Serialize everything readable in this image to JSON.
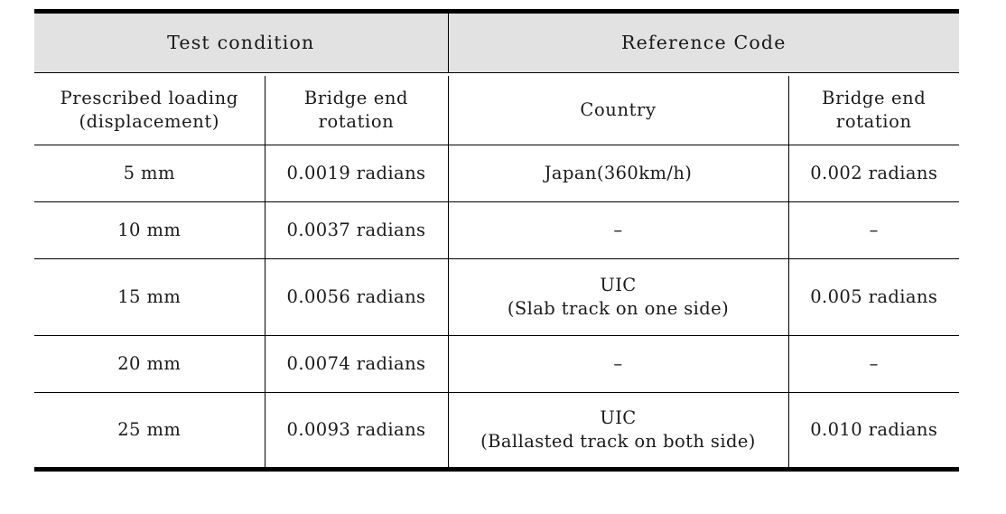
{
  "table": {
    "group_headers": [
      {
        "label": "Test condition",
        "colspan": 2
      },
      {
        "label": "Reference Code",
        "colspan": 2
      }
    ],
    "sub_headers": [
      {
        "line1": "Prescribed loading",
        "line2": "(displacement)"
      },
      {
        "line1": "Bridge end",
        "line2": "rotation"
      },
      {
        "line1": "Country",
        "line2": ""
      },
      {
        "line1": "Bridge end",
        "line2": "rotation"
      }
    ],
    "rows": [
      {
        "prescribed_loading": "5 mm",
        "test_rotation": "0.0019 radians",
        "country_line1": "Japan(360km/h)",
        "country_line2": "",
        "code_rotation": "0.002 radians"
      },
      {
        "prescribed_loading": "10 mm",
        "test_rotation": "0.0037 radians",
        "country_line1": "–",
        "country_line2": "",
        "code_rotation": "–"
      },
      {
        "prescribed_loading": "15 mm",
        "test_rotation": "0.0056 radians",
        "country_line1": "UIC",
        "country_line2": "(Slab track on one side)",
        "code_rotation": "0.005 radians"
      },
      {
        "prescribed_loading": "20 mm",
        "test_rotation": "0.0074 radians",
        "country_line1": "–",
        "country_line2": "",
        "code_rotation": "–"
      },
      {
        "prescribed_loading": "25 mm",
        "test_rotation": "0.0093 radians",
        "country_line1": "UIC",
        "country_line2": "(Ballasted track on both side)",
        "code_rotation": "0.010 radians"
      }
    ],
    "colors": {
      "header_background": "#e2e2e2",
      "rule": "#000000",
      "text": "#1a1a1a",
      "page_background": "#ffffff"
    }
  }
}
